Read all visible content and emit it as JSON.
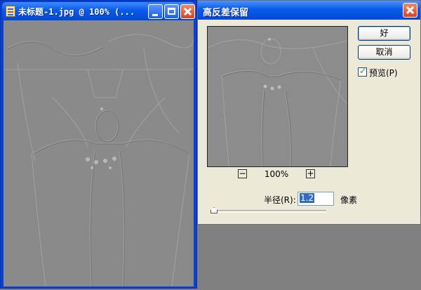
{
  "document_window": {
    "title": "未标题-1.jpg @ 100% (...",
    "minimize_label": "",
    "maximize_label": "",
    "close_label": ""
  },
  "dialog": {
    "title": "高反差保留",
    "ok_label": "好",
    "cancel_label": "取消",
    "preview_label": "预览(P)",
    "preview_checked": true,
    "zoom": "100%",
    "radius_label": "半径(R):",
    "radius_value": "1.2",
    "radius_unit": "像素"
  },
  "colors": {
    "titlebar": "#0a5ae8",
    "dialog_bg": "#ece9d8",
    "workspace": "#808080"
  }
}
